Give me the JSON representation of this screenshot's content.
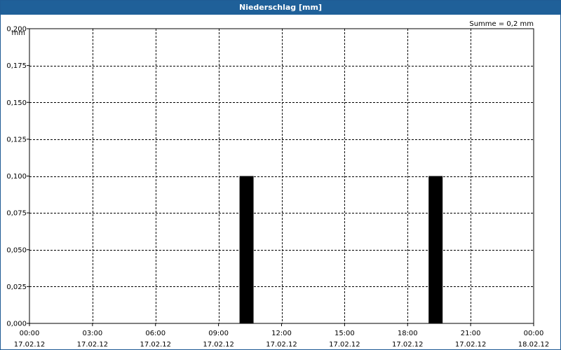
{
  "window": {
    "title": "Niederschlag [mm]"
  },
  "chart_data": {
    "type": "bar",
    "title": "Niederschlag [mm]",
    "ylabel": "mm",
    "annotation": "Summe = 0,2 mm",
    "ylim": [
      0,
      0.2
    ],
    "yticks": [
      "0,000",
      "0,025",
      "0,050",
      "0,075",
      "0,100",
      "0,125",
      "0,150",
      "0,175",
      "0,200"
    ],
    "xlim_hours": [
      0,
      24
    ],
    "xticks": [
      {
        "time": "00:00",
        "date": "17.02.12"
      },
      {
        "time": "03:00",
        "date": "17.02.12"
      },
      {
        "time": "06:00",
        "date": "17.02.12"
      },
      {
        "time": "09:00",
        "date": "17.02.12"
      },
      {
        "time": "12:00",
        "date": "17.02.12"
      },
      {
        "time": "15:00",
        "date": "17.02.12"
      },
      {
        "time": "18:00",
        "date": "17.02.12"
      },
      {
        "time": "21:00",
        "date": "17.02.12"
      },
      {
        "time": "00:00",
        "date": "18.02.12"
      }
    ],
    "bars": [
      {
        "start": "17.02.12 10:00",
        "end": "17.02.12 10:40",
        "value": 0.1
      },
      {
        "start": "17.02.12 19:00",
        "end": "17.02.12 19:40",
        "value": 0.1
      }
    ],
    "grid": true,
    "bar_color": "#000000"
  }
}
